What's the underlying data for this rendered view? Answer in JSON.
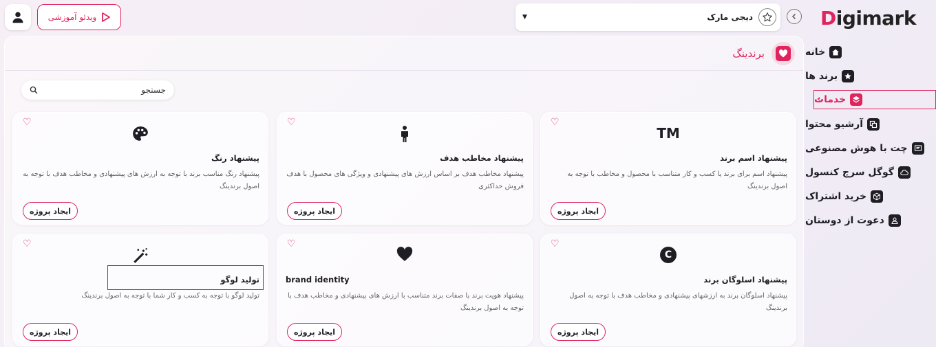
{
  "header": {
    "video_label": "ویدئو آموزشی",
    "brand_name": "دیجی مارک",
    "logo_text": "igimark",
    "logo_letter": "D"
  },
  "sidebar": {
    "items": [
      {
        "label": "خانه",
        "icon": "home-icon"
      },
      {
        "label": "برند ها",
        "icon": "star-icon"
      },
      {
        "label": "خدمات",
        "icon": "layers-icon",
        "active": true
      },
      {
        "label": "آرشیو محتوا",
        "icon": "copy-icon"
      },
      {
        "label": "چت با هوش مصنوعی",
        "icon": "chat-icon"
      },
      {
        "label": "گوگل سرچ کنسول",
        "icon": "cloud-icon"
      },
      {
        "label": "خرید اشتراک",
        "icon": "box-icon"
      },
      {
        "label": "دعوت از دوستان",
        "icon": "users-icon"
      }
    ]
  },
  "main": {
    "title": "برندینگ",
    "search_placeholder": "جستجو",
    "create_label": "ایجاد پروژه"
  },
  "cards": [
    {
      "title": "پیشنهاد اسم برند",
      "desc": "پیشنهاد اسم برای برند یا کسب و کار متناسب با محصول و مخاطب با توجه به اصول برندینگ",
      "icon": "trademark-icon",
      "icon_text": "TM"
    },
    {
      "title": "پیشنهاد مخاطب هدف",
      "desc": "پیشنهاد مخاطب هدف بر اساس ارزش های پیشنهادی و ویژگی های محصول با هدف فروش حداکثری",
      "icon": "person-icon"
    },
    {
      "title": "پیشنهاد رنگ",
      "desc": "پیشنهاد رنگ مناسب برند با توجه به ارزش های پیشنهادی و مخاطب هدف با توجه به اصول برندینگ",
      "icon": "palette-icon"
    },
    {
      "title": "پیشنهاد اسلوگان برند",
      "desc": "پیشنهاد اسلوگان برند به ارزشهای پیشنهادی و مخاطب هدف با توجه به اصول برندینگ",
      "icon": "copyright-icon",
      "icon_text": "C"
    },
    {
      "title": "brand identity",
      "desc": "پیشنهاد هویت برند با صفات برند متناسب با ارزش های پیشنهادی و مخاطب هدف با توجه به اصول برندینگ",
      "icon": "heart-icon"
    },
    {
      "title": "تولید لوگو",
      "desc": "تولید لوگو با توجه به کسب و کار شما با توجه به اصول برندینگ",
      "icon": "magic-wand-icon"
    }
  ],
  "colors": {
    "accent": "#e0245e",
    "text": "#1e1e24"
  }
}
